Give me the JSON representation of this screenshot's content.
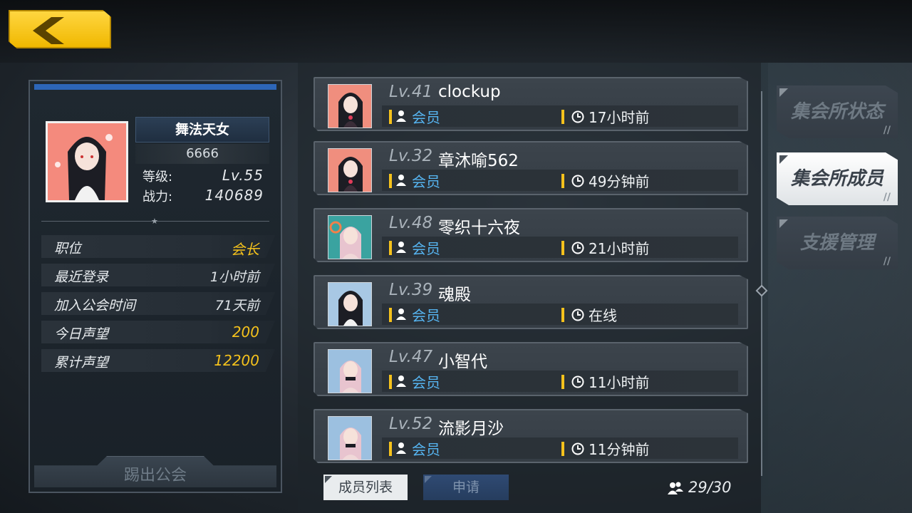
{
  "profile": {
    "name": "舞法天女",
    "id": "6666",
    "level_label": "等级:",
    "level_value": "Lv.55",
    "power_label": "战力:",
    "power_value": "140689",
    "rows": [
      {
        "label": "职位",
        "value": "会长"
      },
      {
        "label": "最近登录",
        "value": "1小时前"
      },
      {
        "label": "加入公会时间",
        "value": "71天前"
      },
      {
        "label": "今日声望",
        "value": "200"
      },
      {
        "label": "累计声望",
        "value": "12200"
      }
    ],
    "kick_label": "踢出公会"
  },
  "members": [
    {
      "level": "Lv.41",
      "name": "clockup",
      "role": "会员",
      "last_seen": "17小时前",
      "avatar_style": "dark-hair-red"
    },
    {
      "level": "Lv.32",
      "name": "章沐喻562",
      "role": "会员",
      "last_seen": "49分钟前",
      "avatar_style": "dark-hair-red"
    },
    {
      "level": "Lv.48",
      "name": "零织十六夜",
      "role": "会员",
      "last_seen": "21小时前",
      "avatar_style": "pink-hair-teal"
    },
    {
      "level": "Lv.39",
      "name": "魂殿",
      "role": "会员",
      "last_seen": "在线",
      "avatar_style": "dark-hair-blue"
    },
    {
      "level": "Lv.47",
      "name": "小智代",
      "role": "会员",
      "last_seen": "11小时前",
      "avatar_style": "pink-hair-blue"
    },
    {
      "level": "Lv.52",
      "name": "流影月沙",
      "role": "会员",
      "last_seen": "11分钟前",
      "avatar_style": "pink-hair-blue"
    }
  ],
  "tabs_right": [
    {
      "label": "集会所状态",
      "active": false
    },
    {
      "label": "集会所成员",
      "active": true
    },
    {
      "label": "支援管理",
      "active": false
    }
  ],
  "tabs_bottom": [
    {
      "label": "成员列表",
      "active": true
    },
    {
      "label": "申请",
      "active": false
    }
  ],
  "member_count": "29/30",
  "colors": {
    "accent_gold": "#f5c21c",
    "role_blue": "#56b4f0",
    "back_yellow": "#ffd640"
  }
}
